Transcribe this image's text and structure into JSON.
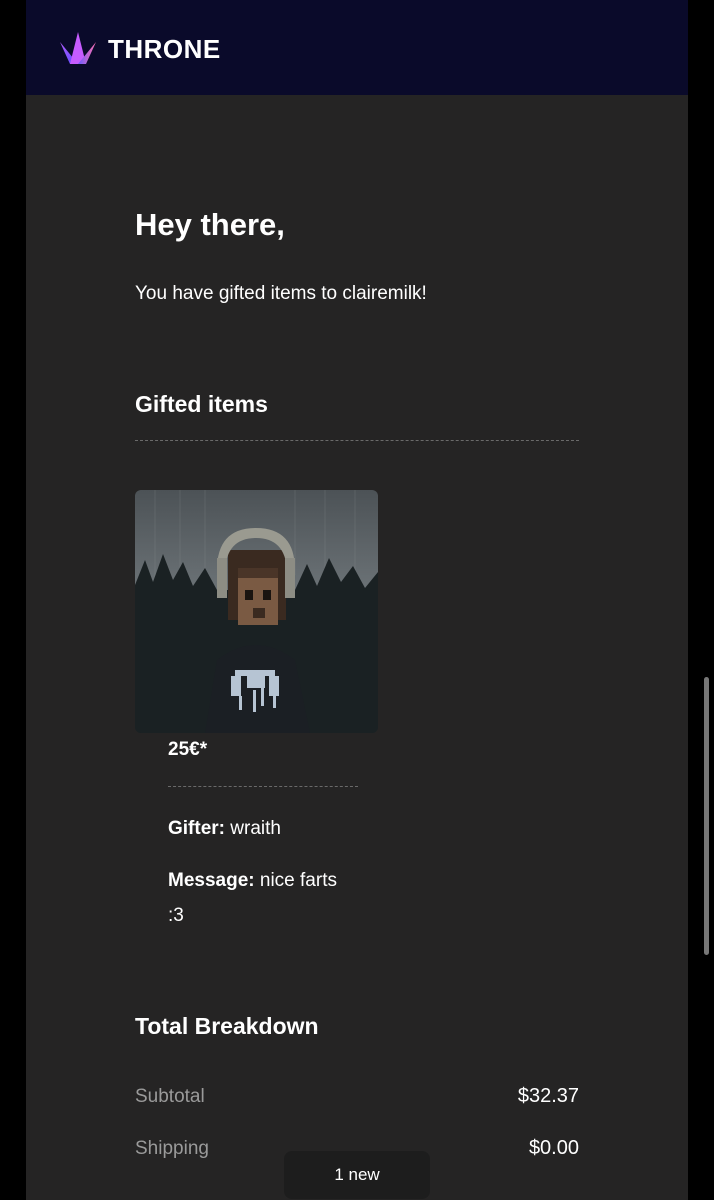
{
  "brand": {
    "name": "THRONE"
  },
  "email": {
    "greeting": "Hey there,",
    "intro": "You have gifted items to clairemilk!",
    "gifted_section_title": "Gifted items",
    "item": {
      "price": "25€*",
      "gifter_label": "Gifter:",
      "gifter_value": " wraith",
      "message_label": "Message:",
      "message_value": " nice farts :3"
    },
    "breakdown_title": "Total Breakdown",
    "breakdown": [
      {
        "label": "Subtotal",
        "value": "$32.37"
      },
      {
        "label": "Shipping",
        "value": "$0.00"
      }
    ]
  },
  "toast": {
    "text": "1 new"
  }
}
